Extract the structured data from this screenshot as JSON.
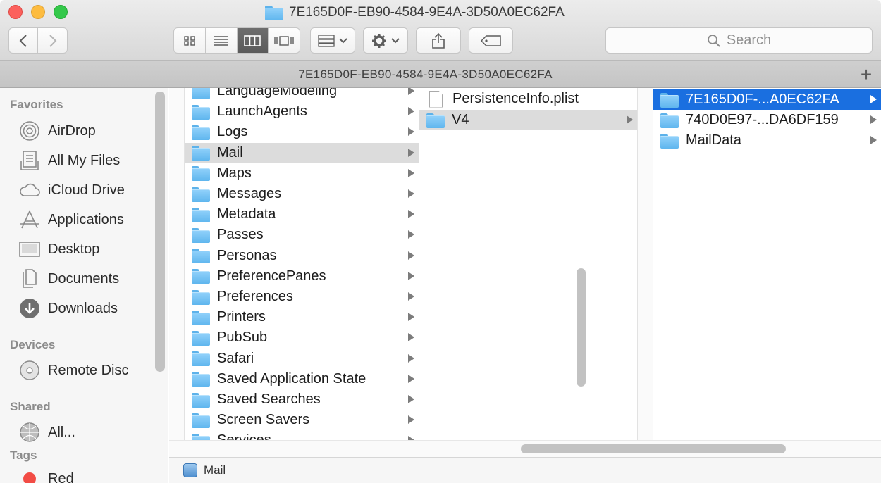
{
  "window": {
    "title": "7E165D0F-EB90-4584-9E4A-3D50A0EC62FA",
    "tab_title": "7E165D0F-EB90-4584-9E4A-3D50A0EC62FA"
  },
  "toolbar": {
    "back_icon": "chevron-left-icon",
    "forward_icon": "chevron-right-icon",
    "view_modes": [
      "icon-view",
      "list-view",
      "column-view",
      "coverflow-view"
    ],
    "active_view": "column-view",
    "search_placeholder": "Search"
  },
  "sidebar": {
    "sections": [
      {
        "heading": "Favorites",
        "items": [
          {
            "label": "AirDrop",
            "icon": "airdrop-icon"
          },
          {
            "label": "All My Files",
            "icon": "all-files-icon"
          },
          {
            "label": "iCloud Drive",
            "icon": "cloud-icon"
          },
          {
            "label": "Applications",
            "icon": "applications-icon"
          },
          {
            "label": "Desktop",
            "icon": "desktop-icon"
          },
          {
            "label": "Documents",
            "icon": "documents-icon"
          },
          {
            "label": "Downloads",
            "icon": "downloads-icon"
          }
        ]
      },
      {
        "heading": "Devices",
        "items": [
          {
            "label": "Remote Disc",
            "icon": "disc-icon"
          }
        ]
      },
      {
        "heading": "Shared",
        "items": [
          {
            "label": "All...",
            "icon": "network-icon"
          }
        ]
      },
      {
        "heading": "Tags",
        "items": [
          {
            "label": "Red",
            "icon": "red-tag-icon",
            "color": "#f24c45"
          }
        ]
      }
    ]
  },
  "columns": {
    "library": [
      "LanguageModeling",
      "LaunchAgents",
      "Logs",
      "Mail",
      "Maps",
      "Messages",
      "Metadata",
      "Passes",
      "Personas",
      "PreferencePanes",
      "Preferences",
      "Printers",
      "PubSub",
      "Safari",
      "Saved Application State",
      "Saved Searches",
      "Screen Savers",
      "Services"
    ],
    "library_selected": "Mail",
    "mail": [
      {
        "name": "PersistenceInfo.plist",
        "kind": "file"
      },
      {
        "name": "V4",
        "kind": "folder"
      }
    ],
    "mail_selected": "V4",
    "v4": [
      "7E165D0F-...A0EC62FA",
      "740D0E97-...DA6DF159",
      "MailData"
    ],
    "v4_selected": "7E165D0F-...A0EC62FA"
  },
  "pathbar": {
    "label": "Mail"
  },
  "colors": {
    "selection_blue": "#1a6fe0",
    "folder_blue": "#5fb6ee"
  }
}
